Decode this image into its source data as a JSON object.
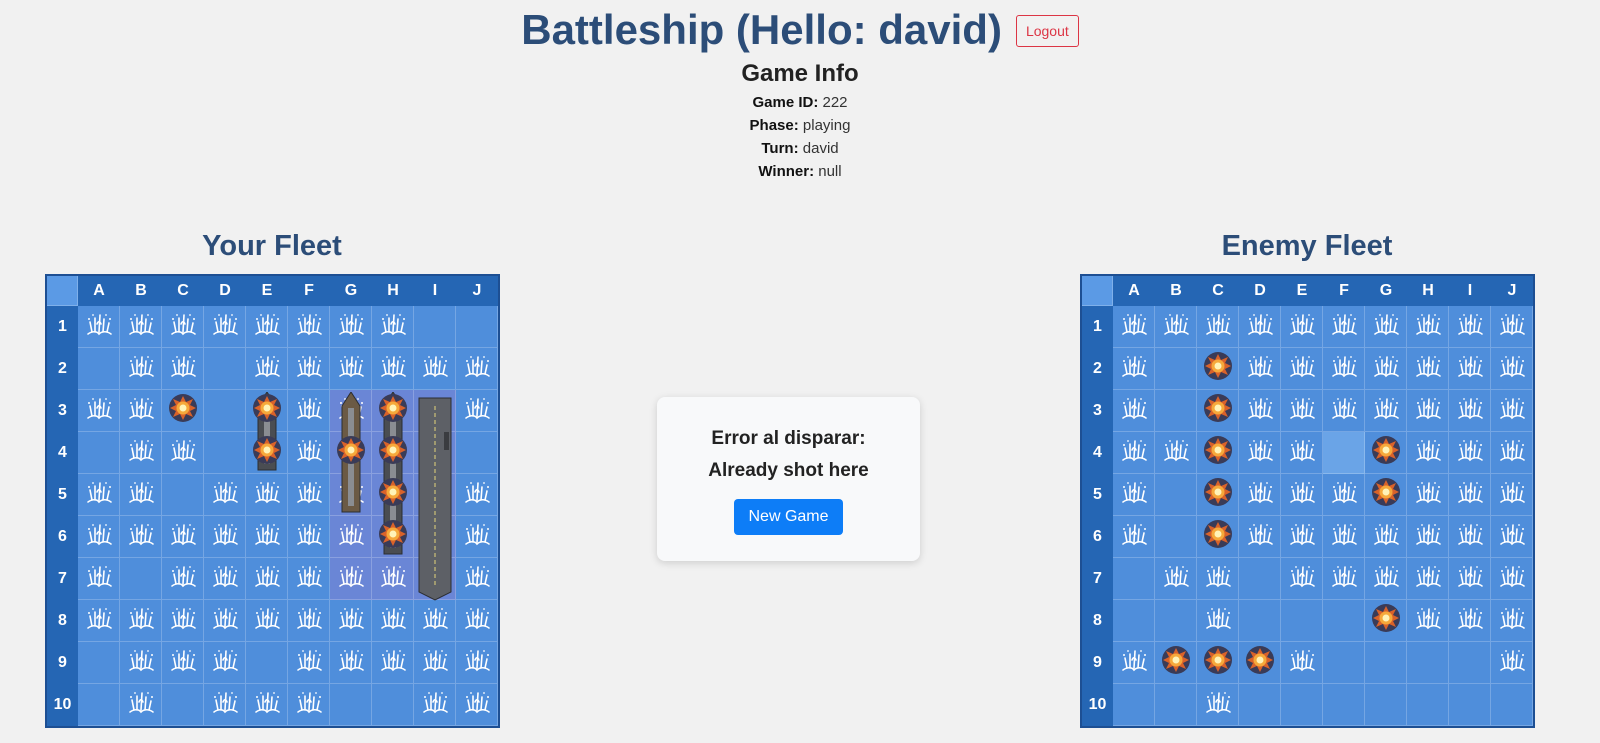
{
  "header": {
    "title": "Battleship (Hello: david)",
    "logout_label": "Logout"
  },
  "game_info": {
    "title": "Game Info",
    "game_id_label": "Game ID:",
    "game_id": "222",
    "phase_label": "Phase:",
    "phase": "playing",
    "turn_label": "Turn:",
    "turn": "david",
    "winner_label": "Winner:",
    "winner": "null"
  },
  "modal": {
    "line1": "Error al disparar:",
    "line2": "Already shot here",
    "button_label": "New Game"
  },
  "columns": [
    "A",
    "B",
    "C",
    "D",
    "E",
    "F",
    "G",
    "H",
    "I",
    "J"
  ],
  "rows": [
    "1",
    "2",
    "3",
    "4",
    "5",
    "6",
    "7",
    "8",
    "9",
    "10"
  ],
  "your_fleet": {
    "title": "Your Fleet",
    "grid": [
      "SSSSSSSS..",
      ".SS.SSSSSS",
      "SSX.XSSXSS",
      ".SS.XSXXS.",
      "SS.SSSSXSS",
      "SSSSSSSXSS",
      "S.SSSSSS.S",
      "SSSSSSSSSS",
      ".SSS.SSSSS",
      ".S.SSS..SS"
    ],
    "ships": [
      {
        "name": "destroyer",
        "col": "E",
        "row": 3,
        "length": 2,
        "orientation": "vertical"
      },
      {
        "name": "battleship",
        "col": "G",
        "row": 3,
        "length": 3,
        "orientation": "vertical"
      },
      {
        "name": "submarine",
        "col": "H",
        "row": 3,
        "length": 4,
        "orientation": "vertical"
      },
      {
        "name": "carrier",
        "col": "I",
        "row": 3,
        "length": 5,
        "orientation": "vertical"
      }
    ],
    "highlight_cols": [
      "G",
      "H",
      "I"
    ]
  },
  "enemy_fleet": {
    "title": "Enemy Fleet",
    "grid": [
      "SSSSSSSSSS",
      "S.XSSSSSSS",
      "S.XSSSSSSS",
      "SSXSSHXSSS",
      "S.XSSSXSSS",
      "S.XSSSSSSS",
      ".SS.SSSSSS",
      "..S...XSSS",
      "SXXXS....S",
      "..S......."
    ]
  },
  "legend": {
    "S": "splash-miss",
    "X": "explosion-hit",
    "H": "hover-highlight",
    ".": "open-water"
  },
  "colors": {
    "title": "#2c4d78",
    "board_border": "#1d4f93",
    "header_cell": "#2566b4",
    "water": "#4f8edb",
    "logout": "#dc3545",
    "new_game": "#0d7df7"
  }
}
